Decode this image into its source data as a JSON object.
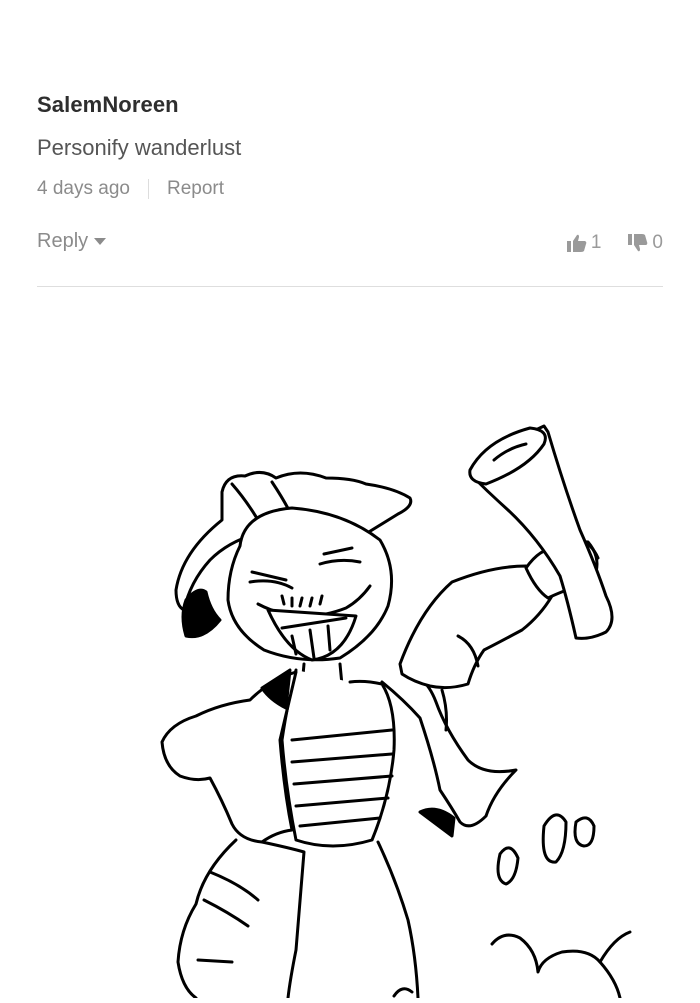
{
  "comment": {
    "author": "SalemNoreen",
    "text": "Personify wanderlust",
    "time": "4 days ago",
    "report_label": "Report",
    "reply_label": "Reply",
    "upvotes": "1",
    "downvotes": "0"
  },
  "drawing": {
    "icon": "character-with-megaphone-sketch",
    "line_color": "#000000"
  }
}
